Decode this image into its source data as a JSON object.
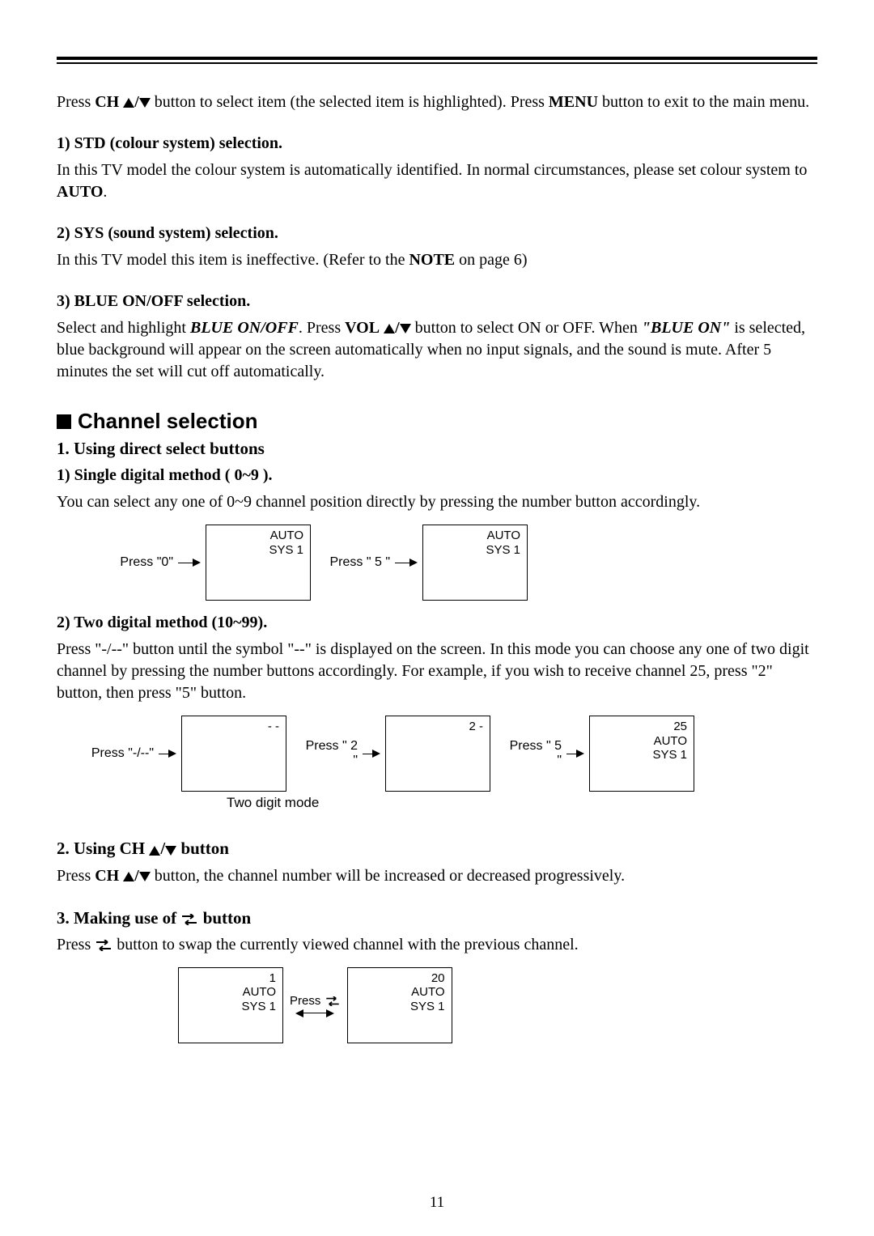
{
  "intro": {
    "press": "Press ",
    "ch": "CH",
    "slash": "/",
    "btn_tail": " button  to select item (the selected item is highlighted). Press ",
    "menu": "MENU",
    "tail": " button to exit to the main menu."
  },
  "std": {
    "head": "1) STD (colour system) selection.",
    "l1a": "In this TV model the colour system is automatically identified. In normal circumstances, please set colour system to ",
    "auto": "AUTO",
    "dot": "."
  },
  "sys": {
    "head": "2) SYS (sound system) selection.",
    "l1a": "In this TV model this item is ineffective. (Refer to the ",
    "note": "NOTE",
    "tail": " on page 6)"
  },
  "blue": {
    "head": "3) BLUE ON/OFF selection.",
    "l1a": "Select and highlight ",
    "bi": "BLUE ON/OFF",
    "l1b": ". Press ",
    "vol": "VOL",
    "l1c": " button to select ON or OFF. When ",
    "quote": "\"BLUE ON\"",
    "l2": " is selected, blue background will appear on the screen automatically when no input signals, and the sound is mute. After 5 minutes the set will cut off automatically."
  },
  "channel": {
    "title": "Channel selection",
    "h1": "1. Using direct select buttons",
    "s1": "1) Single digital method ( 0~9 ).",
    "s1body": "You can select any one of 0~9 channel position directly by pressing the number button accordingly.",
    "d1": {
      "p0": "Press \"0\"",
      "tv0": "AUTO\nSYS 1",
      "p5": "Press \" 5 \"",
      "tv5": "AUTO\nSYS 1"
    },
    "s2": "2) Two digital method (10~99).",
    "s2body": "Press  \"-/--\" button until the symbol \"--\" is displayed on the screen. In this mode you can choose any one of two digit channel by pressing the number buttons accordingly. For example, if you wish to receive channel 25, press \"2\" button, then press \"5\" button.",
    "d2": {
      "p0": "Press \"-/--\"",
      "tv0": "- -",
      "p2": "Press \" 2 \"",
      "tv2": "2 -",
      "p5": "Press \" 5 \"",
      "tv5": "25\nAUTO\nSYS 1",
      "caption": "Two digit mode"
    },
    "h2a": "2. Using CH",
    "h2b": " button",
    "h2body_a": "Press ",
    "h2body_b": " button, the channel number will be increased or decreased progressively.",
    "h3a": "3. Making use of ",
    "h3b": " button",
    "h3body_a": "Press ",
    "h3body_b": " button to swap the currently viewed channel with the previous channel.",
    "d3": {
      "tvA": "1\nAUTO\nSYS 1",
      "press": "Press ",
      "tvB": "20\nAUTO\nSYS 1"
    }
  },
  "page": "11"
}
